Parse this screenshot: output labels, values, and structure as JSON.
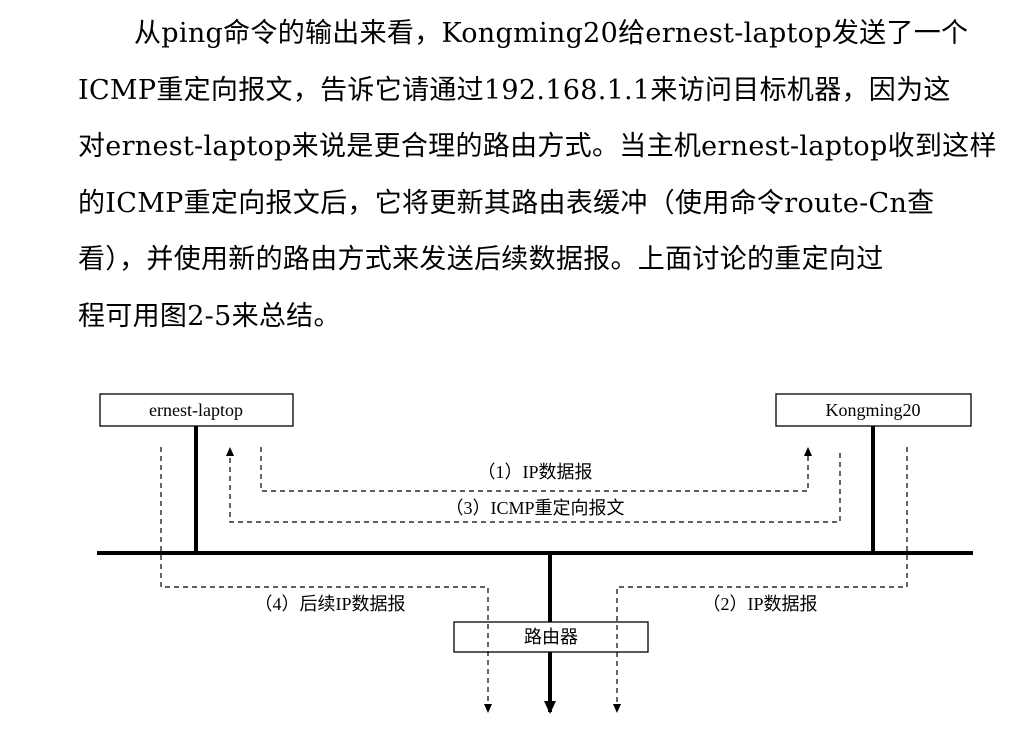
{
  "paragraph": {
    "lines": [
      "从ping命令的输出来看，Kongming20给ernest-laptop发送了一个",
      "ICMP重定向报文，告诉它请通过192.168.1.1来访问目标机器，因为这",
      "对ernest-laptop来说是更合理的路由方式。当主机ernest-laptop收到这样",
      "的ICMP重定向报文后，它将更新其路由表缓冲（使用命令route-Cn查",
      "看），并使用新的路由方式来发送后续数据报。上面讨论的重定向过",
      "程可用图2-5来总结。"
    ]
  },
  "diagram": {
    "host_left": "ernest-laptop",
    "host_right": "Kongming20",
    "router": "路由器",
    "arrows": {
      "a1": "（1）IP数据报",
      "a2": "（2）IP数据报",
      "a3": "（3）ICMP重定向报文",
      "a4": "（4）后续IP数据报"
    }
  }
}
